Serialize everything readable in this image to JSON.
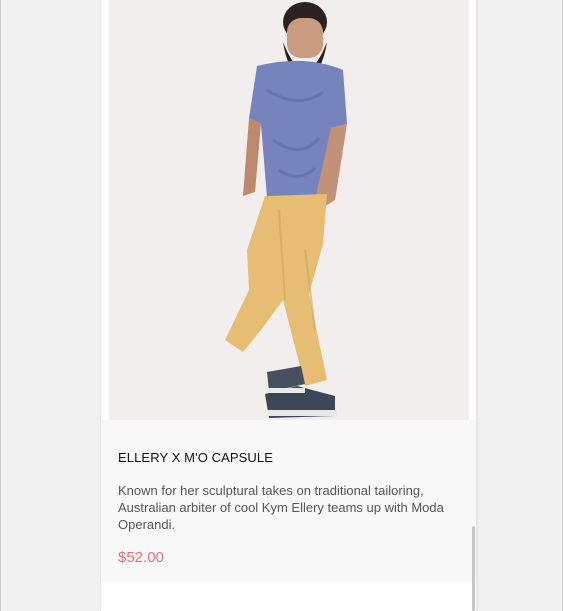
{
  "product": {
    "title": "ELLERY X M'O CAPSULE",
    "description": "Known for her sculptural takes on traditional tailoring, Australian arbiter of cool Kym Ellery teams up with Moda Operandi.",
    "price": "$52.00"
  },
  "colors": {
    "page_background": "#f1f1f1",
    "card_background": "#ffffff",
    "info_panel_background": "#f8f8f8",
    "image_background": "#f3eeee",
    "price": "#e0707a",
    "title": "#111111",
    "description": "#555555"
  }
}
